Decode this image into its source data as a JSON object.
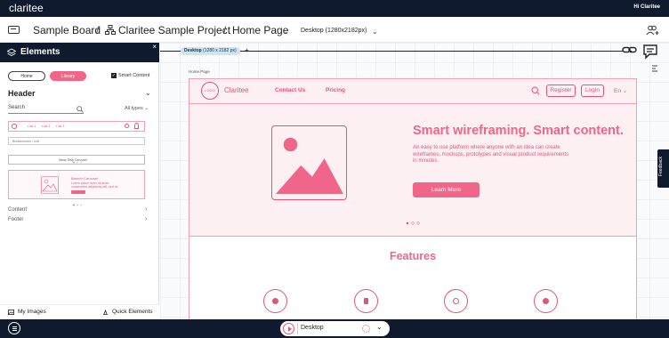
{
  "app": {
    "logo": "claritee",
    "greeting": "Hi Claritee"
  },
  "breadcrumb": {
    "board": "Sample Board",
    "sep1": "/",
    "project": "Claritee Sample Project",
    "sep2": "/",
    "page": "Home Page",
    "viewport": "Desktop (1280x2182px)"
  },
  "panel": {
    "title": "Elements",
    "close": "×",
    "tabs": {
      "home": "Home",
      "library": "Library"
    },
    "smart_content": "Smart Content",
    "section": "Header",
    "search_placeholder": "Search",
    "all_types": "All types",
    "thumbs": {
      "nav_links": [
        "Link 1",
        "Link 2",
        "Link 3"
      ],
      "breadcrumbs": "Breadcrumbs / Link",
      "news_strip": "News Strip Carousel",
      "banner_title": "Banner Carousel",
      "banner_text1": "Lorem ipsum dolor sit amet,",
      "banner_text2": "consectetur adipiscing elit, sed do"
    },
    "accordion": [
      "Content",
      "Footer"
    ],
    "footer": {
      "my_images": "My Images",
      "quick_elements": "Quick Elements"
    }
  },
  "canvas": {
    "device_tab_name": "Desktop",
    "device_tab_size": "(1280 x 2182 px)",
    "add": "+",
    "page_label": "Home Page",
    "wire": {
      "logo": "LOGO",
      "brand": "Claritee",
      "nav": [
        "Contact Us",
        "Pricing"
      ],
      "register": "Register",
      "login": "Login",
      "lang": "En",
      "headline": "Smart wireframing. Smart content.",
      "description": "An easy to use platform where anyone with an idea can create wireframes, mockups, prototypes and visual product requirements in minutes.",
      "cta": "Learn More",
      "features": "Features"
    },
    "feedback": "Feedback"
  },
  "bottom": {
    "device": "Desktop"
  },
  "colors": {
    "accent": "#f0668a",
    "accent_dark": "#e05577",
    "navy": "#0f1a2e",
    "hero_bg": "#fdf0f3"
  }
}
